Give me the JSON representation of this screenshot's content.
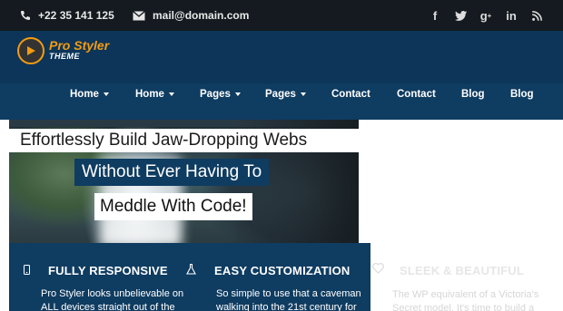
{
  "topbar": {
    "phone": "+22 35 141 125",
    "email": "mail@domain.com",
    "social": [
      "f",
      "t",
      "g+",
      "in",
      "rss"
    ]
  },
  "logo": {
    "line1": "Pro Styler",
    "line2": "THEME"
  },
  "nav": {
    "items": [
      {
        "label": "Home",
        "has_caret": true
      },
      {
        "label": "Home",
        "has_caret": true
      },
      {
        "label": "Pages",
        "has_caret": true
      },
      {
        "label": "Pages",
        "has_caret": true
      },
      {
        "label": "Contact",
        "has_caret": false
      },
      {
        "label": "Contact",
        "has_caret": false
      },
      {
        "label": "Blog",
        "has_caret": false
      },
      {
        "label": "Blog",
        "has_caret": false
      }
    ]
  },
  "hero": {
    "headline": "Effortlessly Build Jaw-Dropping Webs",
    "sub1": "Without Ever Having To",
    "sub2": "Meddle With Code!"
  },
  "features": [
    {
      "title": "FULLY RESPONSIVE",
      "icon": "mobile-icon",
      "body1": "Pro Styler looks unbelievable on",
      "body2": "ALL devices straight out of the"
    },
    {
      "title": "EASY CUSTOMIZATION",
      "icon": "flask-icon",
      "body1": "So simple to use that a caveman",
      "body2": "walking into the 21st century for"
    },
    {
      "title": "SLEEK & BEAUTIFUL",
      "icon": "heart-icon",
      "body1": "The WP equivalent of a Victoria's",
      "body2": "Secret model. It's time to build a"
    }
  ],
  "colors": {
    "topbar": "#141a1f",
    "header": "#0c3559",
    "accent": "#f39c12"
  }
}
